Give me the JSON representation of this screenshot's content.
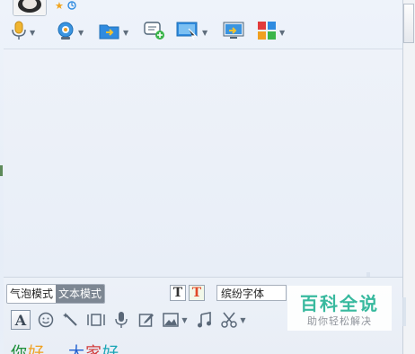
{
  "toolbar": {
    "items": [
      {
        "icon": "microphone-icon"
      },
      {
        "icon": "webcam-icon"
      },
      {
        "icon": "send-file-icon"
      },
      {
        "icon": "add-chat-icon"
      },
      {
        "icon": "remote-assist-icon"
      },
      {
        "icon": "share-screen-icon"
      },
      {
        "icon": "apps-grid-icon"
      }
    ]
  },
  "input": {
    "mode_bubble": "气泡模式",
    "mode_text": "文本模式",
    "format_plain": "T",
    "format_color": "T",
    "font_name": "缤纷字体",
    "typed_parts": [
      "你",
      "好",
      "大",
      "家",
      "好"
    ]
  },
  "watermark": {
    "title": "百科全说",
    "subtitle": "助你轻松解决"
  },
  "colors": {
    "accent_blue": "#2f8be0",
    "watermark_green": "#2fb79a"
  }
}
